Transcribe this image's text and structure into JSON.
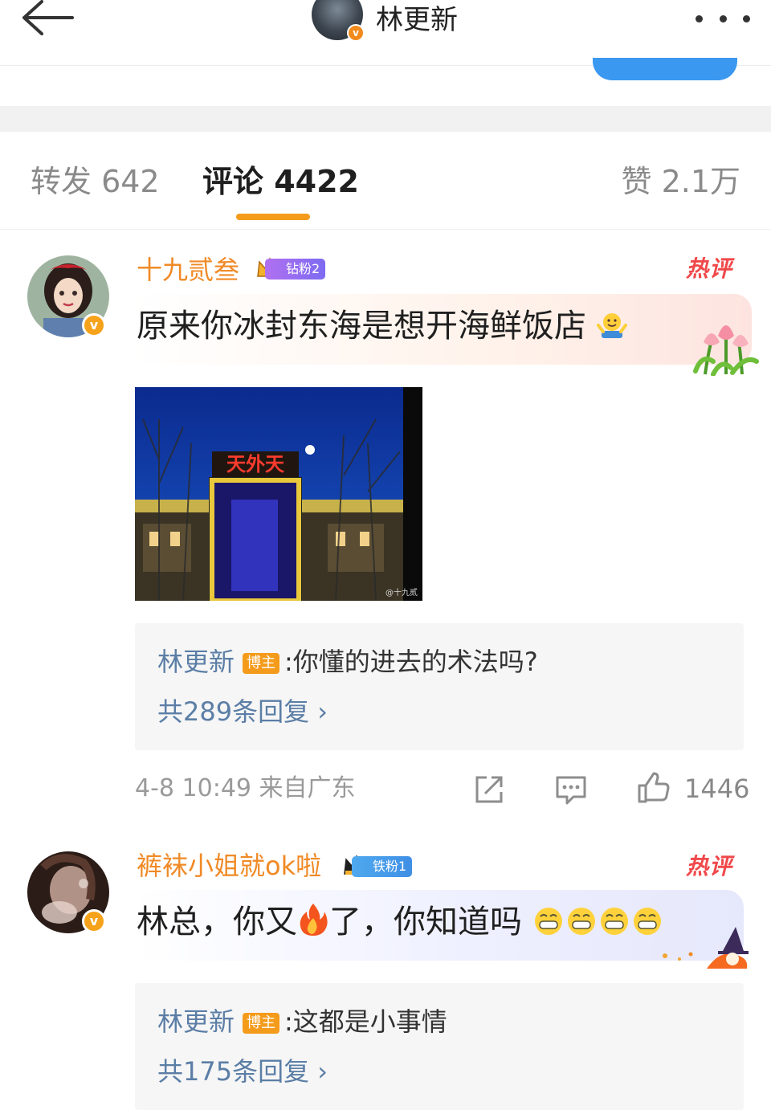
{
  "header": {
    "title": "林更新"
  },
  "tabs": {
    "repost": "转发 642",
    "comment": "评论 4422",
    "like": "赞 2.1万"
  },
  "comments": [
    {
      "username": "十九贰叁",
      "fan_badge": "钻粉2",
      "hot_label": "热评",
      "text": "原来你冰封东海是想开海鲜饭店",
      "emoji": "hands-up-emoji",
      "image": {
        "sign_text": "天外天",
        "watermark": "@十九贰"
      },
      "reply": {
        "author": "林更新",
        "author_tag": "博主",
        "text": ":你懂的进去的术法吗?",
        "count": "共289条回复 ›"
      },
      "meta": "4-8 10:49  来自广东",
      "likes": "1446"
    },
    {
      "username": "裤袜小姐就ok啦",
      "fan_badge": "铁粉1",
      "hot_label": "热评",
      "text_before": "林总，你又",
      "text_after": "了，你知道吗",
      "emoji": "fire-emoji",
      "reply": {
        "author": "林更新",
        "author_tag": "博主",
        "text": ":这都是小事情",
        "count": "共175条回复 ›"
      }
    }
  ],
  "colors": {
    "accent": "#f59b1b",
    "username": "#f08a26",
    "link": "#5b7ea6",
    "hot": "#f0484a"
  }
}
